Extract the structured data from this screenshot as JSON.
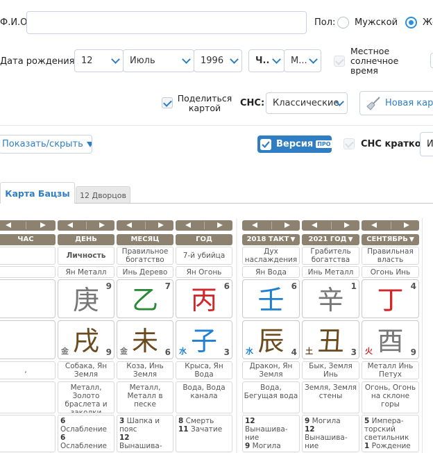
{
  "form": {
    "fio_label": "Ф.И.О.",
    "fio_value": "",
    "gender_label": "Пол:",
    "gender_male": "Мужской",
    "gender_female": "Жен",
    "birth_label": "Дата рождения",
    "day": "12",
    "month": "Июль",
    "year": "1996",
    "hour": "Ч..",
    "minute": "М...",
    "solar_time_label": "Местное солнечное время",
    "share_label": "Поделиться картой",
    "sns_label": "СНС:",
    "sns_value": "Классические",
    "new_card_label": "Новая карт"
  },
  "toolbar": {
    "show_hide_label": "Показать/скрыть",
    "version_label": "Версия",
    "pro_badge": "ПРО",
    "sns_short_label": "СНС кратко",
    "cut_label": "И"
  },
  "tabs": [
    {
      "label": "Карта Бацзы",
      "active": true
    },
    {
      "label": "12 Дворцов",
      "active": false
    }
  ],
  "colors": {
    "accent": "#2f7ec4",
    "header_bg": "#8d8170",
    "wood": "#2b8a3a",
    "fire": "#d0282a",
    "water": "#1f7fd1",
    "metal": "#777777",
    "earth": "#6b4a1e"
  },
  "pillars": {
    "hour": {
      "header": "ЧАС",
      "star": "",
      "stem_element": "",
      "stem_char": "",
      "stem_num": "",
      "branch_char": "",
      "branch_elem_char": "",
      "branch_num": "",
      "animal": ",",
      "nayin": "",
      "stat1_num": "",
      "stat1_text": "",
      "stat2_num": "",
      "stat2_text": ""
    },
    "day": {
      "header": "ДЕНЬ",
      "star": "Личность",
      "stem_element": "Ян Металл",
      "stem_char": "庚",
      "stem_num": "9",
      "branch_char": "戌",
      "branch_elem_char": "金",
      "branch_num": "9",
      "animal": "Собака, Ян Земля",
      "nayin": "Металл, Золото браслета и заколки",
      "stat1_num": "6",
      "stat1_text": "Ослабление",
      "stat2_num": "6",
      "stat2_text": "Ослабление"
    },
    "month": {
      "header": "МЕСЯЦ",
      "star": "Правильное богатство",
      "stem_element": "Инь Дерево",
      "stem_char": "乙",
      "stem_num": "7",
      "branch_char": "未",
      "branch_elem_char": "金",
      "branch_num": "6",
      "animal": "Коза, Инь Земля",
      "nayin": "Металл, Металл в песке",
      "stat1_num": "3",
      "stat1_text": "Шапка и пояс",
      "stat2_num": "12",
      "stat2_text": "Вынашива-ние"
    },
    "year": {
      "header": "ГОД",
      "star": "7-й убийца",
      "stem_element": "Ян Огонь",
      "stem_char": "丙",
      "stem_num": "6",
      "branch_char": "子",
      "branch_elem_char": "水",
      "branch_num": "3",
      "animal": "Крыса, Ян Вода",
      "nayin": "Вода, Вода канала",
      "stat1_num": "8",
      "stat1_text": "Смерть",
      "stat2_num": "11",
      "stat2_text": "Зачатие"
    },
    "takt": {
      "header": "2018 ТАКТ",
      "star": "Дух наслаждения",
      "stem_element": "Ян Вода",
      "stem_char": "壬",
      "stem_num": "6",
      "branch_char": "辰",
      "branch_elem_char": "水",
      "branch_num": "4",
      "animal": "Дракон, Ян Земля",
      "nayin": "Вода, Бегущая вода",
      "stat1_num": "12",
      "stat1_text": "Вынашива-ние",
      "stat2_num": "9",
      "stat2_text": "Могила"
    },
    "yearcur": {
      "header": "2021 ГОД",
      "star": "Грабитель богатства",
      "stem_element": "Инь Металл",
      "stem_char": "辛",
      "stem_num": "1",
      "branch_char": "丑",
      "branch_elem_char": "土",
      "branch_num": "3",
      "animal": "Бык, Земля Инь",
      "nayin": "Земля, Земля стены",
      "stat1_num": "9",
      "stat1_text": "Могила",
      "stat2_num": "12",
      "stat2_text": "Вынашива-ние"
    },
    "monthcur": {
      "header": "СЕНТЯБРЬ",
      "star": "Правильная власть",
      "stem_element": "Огонь Инь",
      "stem_char": "丁",
      "stem_num": "4",
      "branch_char": "酉",
      "branch_elem_char": "火",
      "branch_num": "9",
      "animal": "Металл Инь Петух",
      "nayin": "Огонь, Огонь на склоне горы",
      "stat1_num": "5",
      "stat1_text": "Импера-торский светильник",
      "stat2_num": "1",
      "stat2_text": "Рождение"
    }
  }
}
